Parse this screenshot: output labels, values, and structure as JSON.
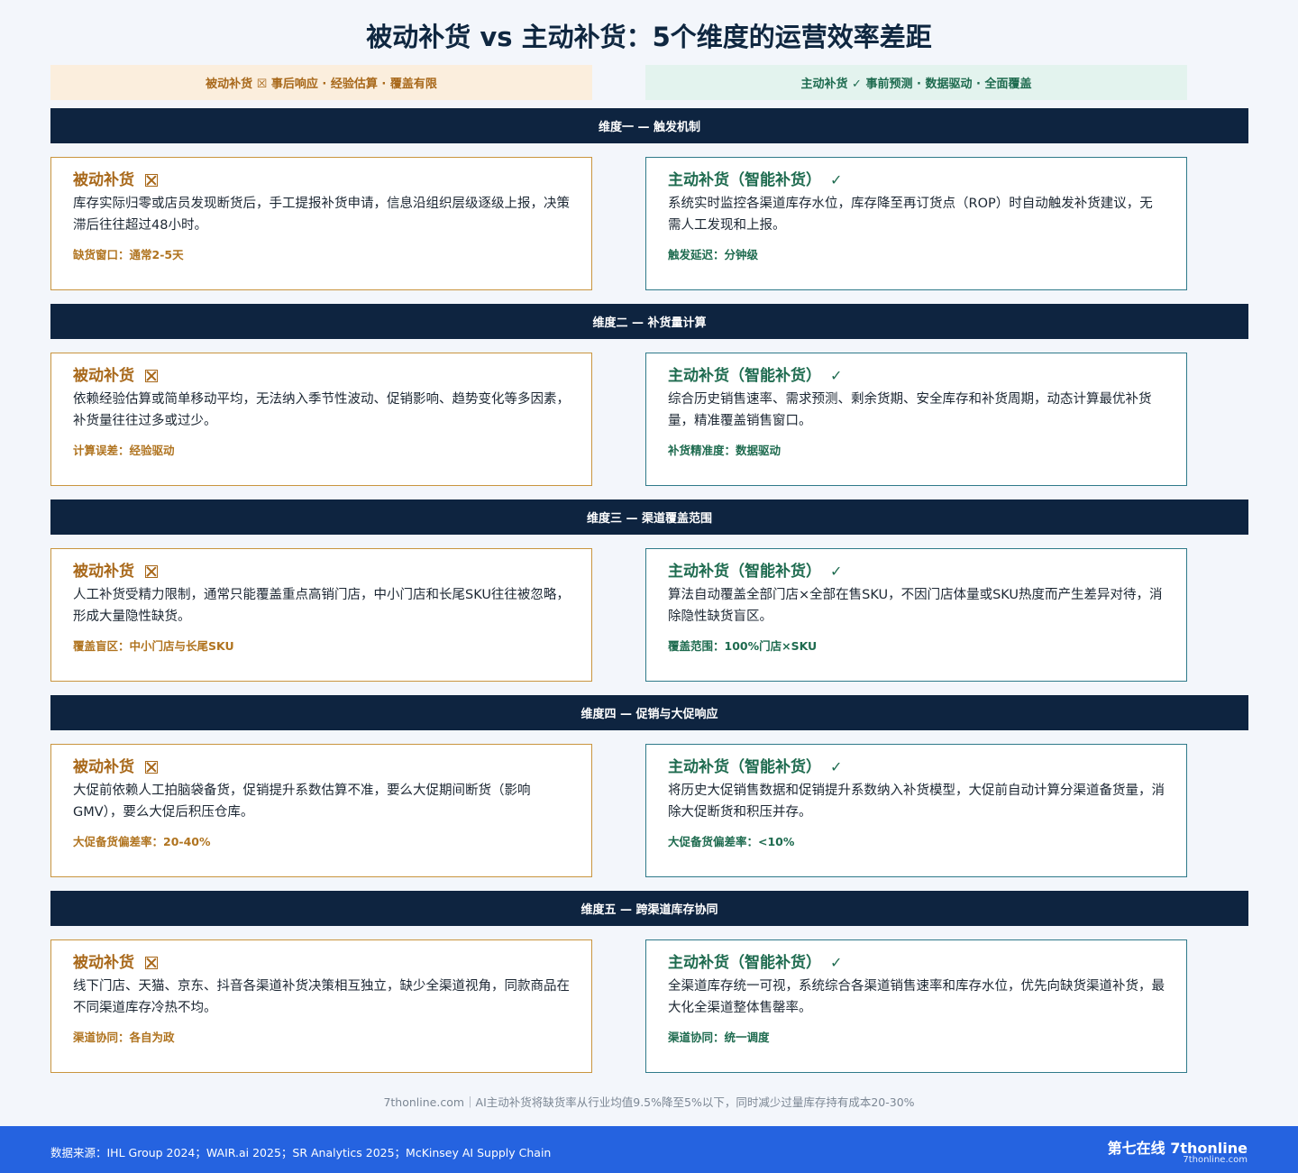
{
  "title": "被动补货 vs 主动补货：5个维度的运营效率差距",
  "legend": {
    "passive": "被动补货 ☒ 事后响应 · 经验估算 · 覆盖有限",
    "active": "主动补货 ✓ 事前预测 · 数据驱动 · 全面覆盖"
  },
  "dimensions": [
    {
      "header": "维度一 — 触发机制",
      "passive": {
        "title": "被动补货",
        "body": "库存实际归零或店员发现断货后，手工提报补货申请，信息沿组织层级逐级上报，决策滞后往往超过48小时。",
        "metric": "缺货窗口：通常2-5天"
      },
      "active": {
        "title": "主动补货（智能补货）",
        "body": "系统实时监控各渠道库存水位，库存降至再订货点（ROP）时自动触发补货建议，无需人工发现和上报。",
        "metric": "触发延迟：分钟级"
      }
    },
    {
      "header": "维度二 — 补货量计算",
      "passive": {
        "title": "被动补货",
        "body": "依赖经验估算或简单移动平均，无法纳入季节性波动、促销影响、趋势变化等多因素，补货量往往过多或过少。",
        "metric": "计算误差：经验驱动"
      },
      "active": {
        "title": "主动补货（智能补货）",
        "body": "综合历史销售速率、需求预测、剩余货期、安全库存和补货周期，动态计算最优补货量，精准覆盖销售窗口。",
        "metric": "补货精准度：数据驱动"
      }
    },
    {
      "header": "维度三 — 渠道覆盖范围",
      "passive": {
        "title": "被动补货",
        "body": "人工补货受精力限制，通常只能覆盖重点高销门店，中小门店和长尾SKU往往被忽略，形成大量隐性缺货。",
        "metric": "覆盖盲区：中小门店与长尾SKU"
      },
      "active": {
        "title": "主动补货（智能补货）",
        "body": "算法自动覆盖全部门店×全部在售SKU，不因门店体量或SKU热度而产生差异对待，消除隐性缺货盲区。",
        "metric": "覆盖范围：100%门店×SKU"
      }
    },
    {
      "header": "维度四 — 促销与大促响应",
      "passive": {
        "title": "被动补货",
        "body": "大促前依赖人工拍脑袋备货，促销提升系数估算不准，要么大促期间断货（影响GMV），要么大促后积压仓库。",
        "metric": "大促备货偏差率：20-40%"
      },
      "active": {
        "title": "主动补货（智能补货）",
        "body": "将历史大促销售数据和促销提升系数纳入补货模型，大促前自动计算分渠道备货量，消除大促断货和积压并存。",
        "metric": "大促备货偏差率：<10%"
      }
    },
    {
      "header": "维度五 — 跨渠道库存协同",
      "passive": {
        "title": "被动补货",
        "body": "线下门店、天猫、京东、抖音各渠道补货决策相互独立，缺少全渠道视角，同款商品在不同渠道库存冷热不均。",
        "metric": "渠道协同：各自为政"
      },
      "active": {
        "title": "主动补货（智能补货）",
        "body": "全渠道库存统一可视，系统综合各渠道销售速率和库存水位，优先向缺货渠道补货，最大化全渠道整体售罄率。",
        "metric": "渠道协同：统一调度"
      }
    }
  ],
  "marks": {
    "active": "✓"
  },
  "footnote": "7thonline.com｜AI主动补货将缺货率从行业均值9.5%降至5%以下，同时减少过量库存持有成本20-30%",
  "footer": {
    "source": "数据来源：IHL Group 2024；WAIR.ai 2025；SR Analytics 2025；McKinsey AI Supply Chain",
    "brand": "第七在线 7thonline",
    "domain": "7thonline.com"
  },
  "colors": {
    "navy": "#0e2440",
    "passive_accent": "#a8681a",
    "active_accent": "#1e6b4f",
    "footer_blue": "#2563e0"
  }
}
